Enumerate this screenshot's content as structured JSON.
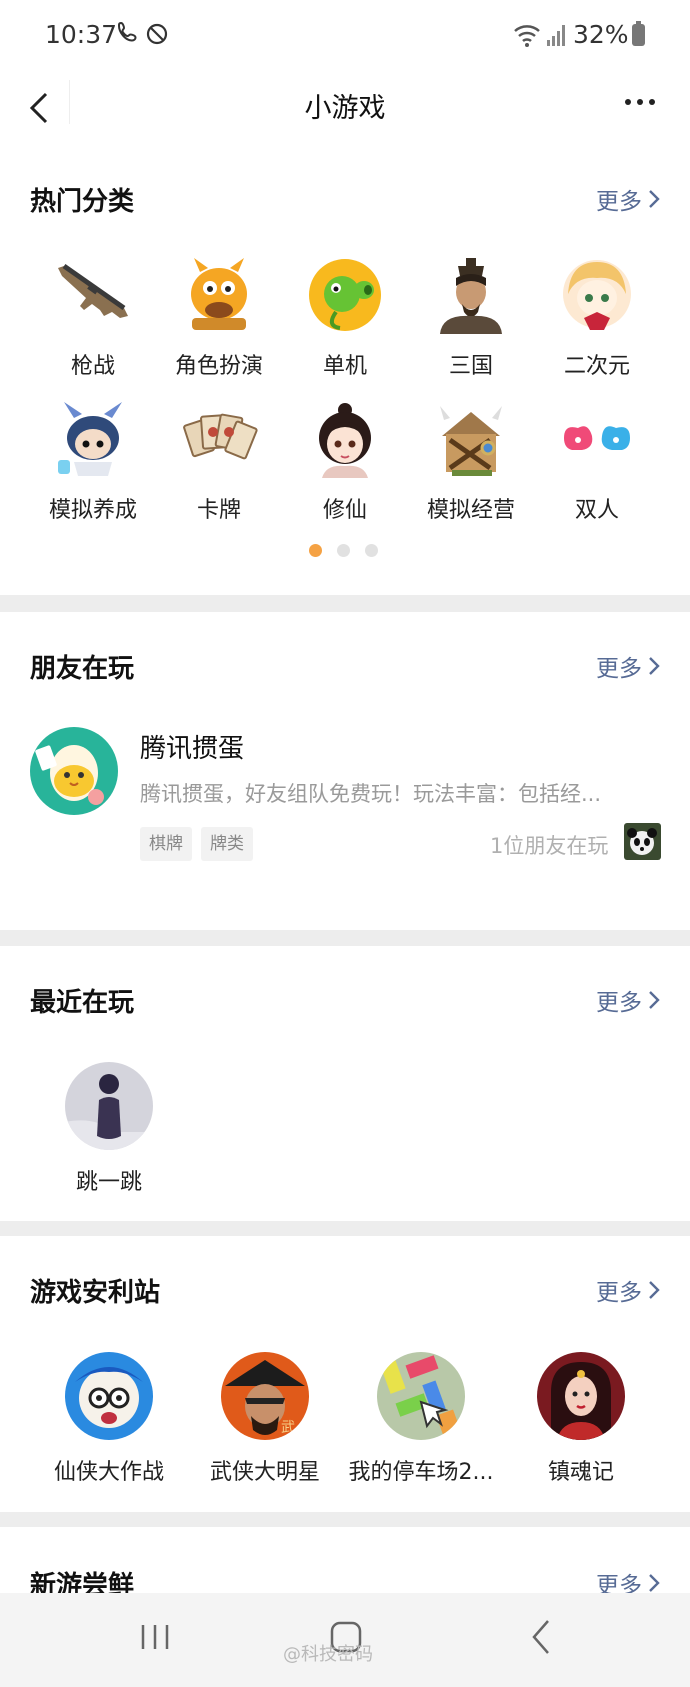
{
  "status_bar": {
    "time": "10:37",
    "battery": "32%"
  },
  "nav": {
    "title": "小游戏",
    "back_icon": "chevron-left-icon",
    "more_icon": "more-dots-icon"
  },
  "hot_categories": {
    "title": "热门分类",
    "more": "更多",
    "items": [
      {
        "label": "枪战",
        "icon": "rifle-icon"
      },
      {
        "label": "角色扮演",
        "icon": "cartoon-beast-icon"
      },
      {
        "label": "单机",
        "icon": "pea-shooter-icon"
      },
      {
        "label": "三国",
        "icon": "warrior-portrait-icon"
      },
      {
        "label": "二次元",
        "icon": "anime-girl-icon"
      },
      {
        "label": "模拟养成",
        "icon": "chibi-character-icon"
      },
      {
        "label": "卡牌",
        "icon": "cards-icon"
      },
      {
        "label": "修仙",
        "icon": "immortal-character-icon"
      },
      {
        "label": "模拟经营",
        "icon": "house-icon"
      },
      {
        "label": "双人",
        "icon": "double-heart-icon"
      }
    ],
    "pager": {
      "pages": 3,
      "active": 1
    },
    "accent_color": "#f5a244"
  },
  "friends_playing": {
    "title": "朋友在玩",
    "more": "更多",
    "game": {
      "name": "腾讯掼蛋",
      "description": "腾讯掼蛋，好友组队免费玩！玩法丰富：包括经...",
      "tags": [
        "棋牌",
        "牌类"
      ],
      "friend_count": "1位朋友在玩",
      "friend_avatar_icon": "panda-avatar-icon"
    }
  },
  "recent_playing": {
    "title": "最近在玩",
    "more": "更多",
    "items": [
      {
        "label": "跳一跳",
        "icon": "jump-piece-icon"
      }
    ]
  },
  "game_gifts": {
    "title": "游戏安利站",
    "more": "更多",
    "items": [
      {
        "label": "仙侠大作战",
        "icon": "cartoon-hero-icon"
      },
      {
        "label": "武侠大明星",
        "icon": "swordsman-icon"
      },
      {
        "label": "我的停车场2...",
        "icon": "parking-puzzle-icon"
      },
      {
        "label": "镇魂记",
        "icon": "heroine-icon"
      }
    ]
  },
  "new_games": {
    "title": "新游尝鲜",
    "more": "更多"
  },
  "system_nav": {
    "recents_icon": "recents-icon",
    "home_icon": "home-icon",
    "back_icon": "back-icon"
  },
  "watermark": "@科技密码",
  "link_color": "#576b95"
}
